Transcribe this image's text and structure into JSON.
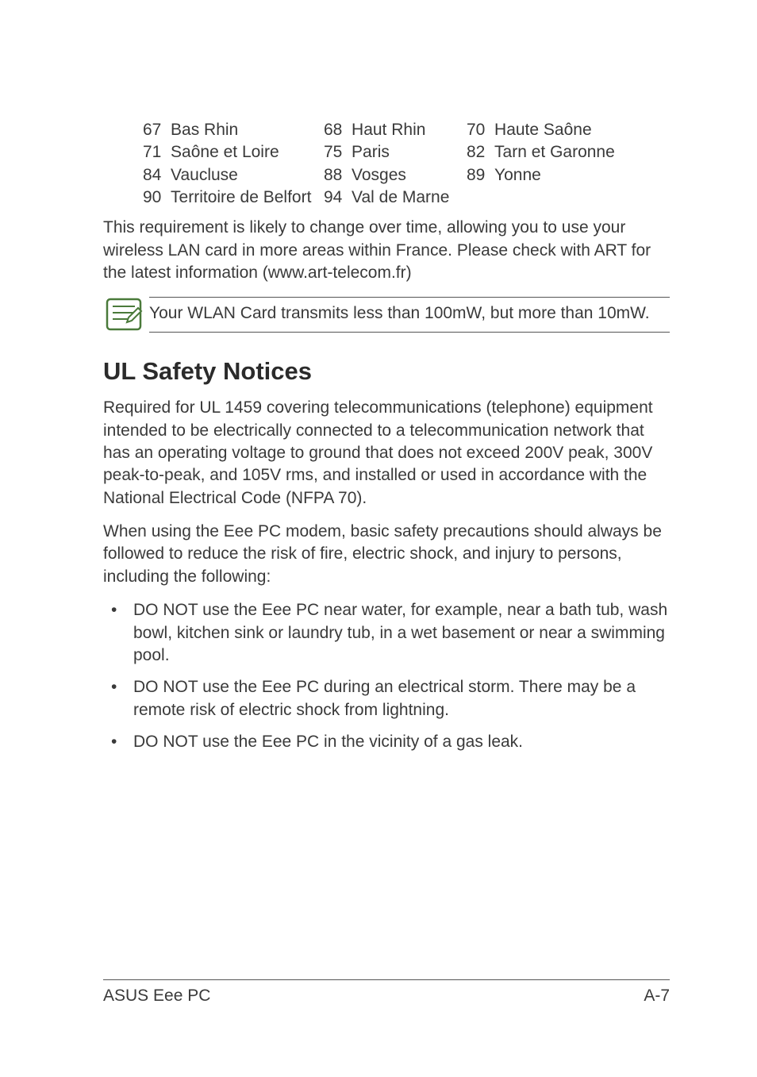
{
  "departments": [
    [
      {
        "num": "67",
        "name": "Bas Rhin"
      },
      {
        "num": "68",
        "name": "Haut Rhin"
      },
      {
        "num": "70",
        "name": "Haute Saône"
      }
    ],
    [
      {
        "num": "71",
        "name": "Saône et Loire"
      },
      {
        "num": "75",
        "name": "Paris"
      },
      {
        "num": "82",
        "name": "Tarn et Garonne"
      }
    ],
    [
      {
        "num": "84",
        "name": "Vaucluse"
      },
      {
        "num": "88",
        "name": "Vosges"
      },
      {
        "num": "89",
        "name": "Yonne"
      }
    ],
    [
      {
        "num": "90",
        "name": "Territoire de Belfort"
      },
      {
        "num": "94",
        "name": "Val de Marne"
      }
    ]
  ],
  "para1": "This requirement is likely to change over time, allowing you to use your wireless LAN card in more areas within France. Please check with ART for the latest information (www.art-telecom.fr)",
  "note": "Your WLAN Card transmits less than 100mW, but more than 10mW.",
  "heading": "UL Safety Notices",
  "para2": "Required for UL 1459 covering telecommunications (telephone) equipment intended to be electrically connected to a telecommunication network that has an operating voltage to ground that does not exceed 200V peak, 300V peak-to-peak, and 105V rms, and installed or used in accordance with the National Electrical Code (NFPA 70).",
  "para3": "When using the Eee PC modem, basic safety precautions should always be followed to reduce the risk of fire, electric shock, and injury to persons, including the following:",
  "bullets": [
    "DO NOT use the Eee PC near water, for example, near a bath tub, wash bowl, kitchen sink or laundry tub, in a wet basement or near a swimming pool.",
    "DO NOT use the Eee PC during an electrical storm. There may be a remote risk of electric shock from lightning.",
    "DO NOT use the Eee PC in the vicinity of a gas leak."
  ],
  "footer": {
    "left": "ASUS Eee PC",
    "right": "A-7"
  }
}
